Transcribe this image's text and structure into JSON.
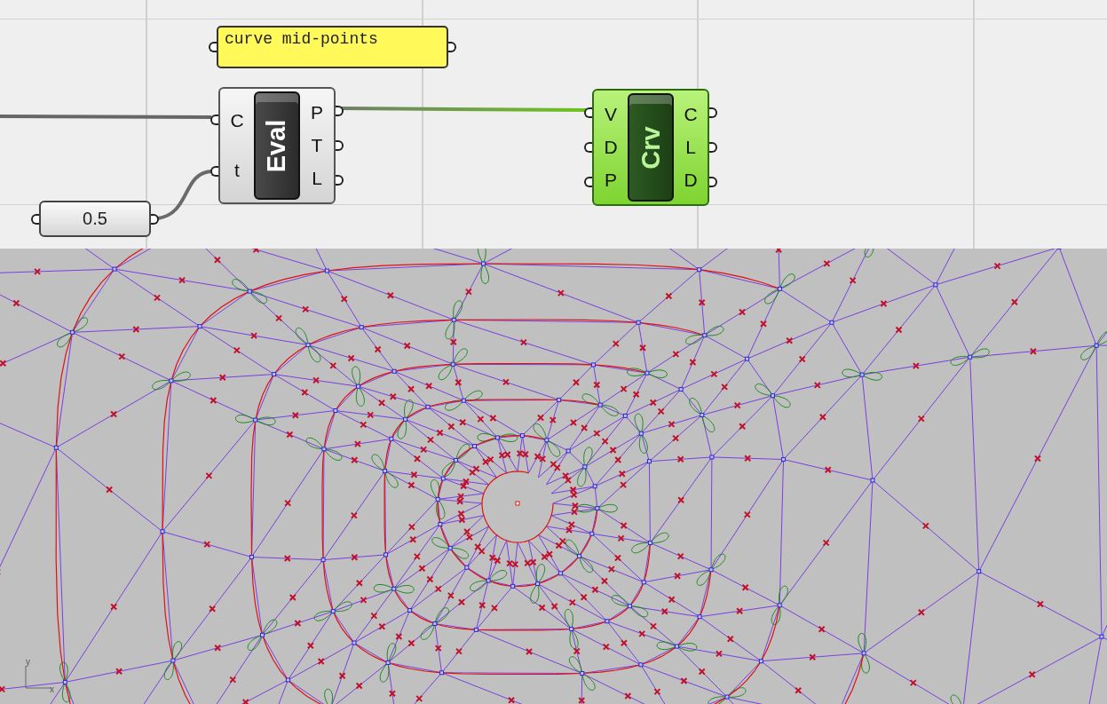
{
  "canvas": {
    "panel": {
      "text": "curve mid-points"
    },
    "slider": {
      "value": "0.5"
    },
    "components": [
      {
        "name": "Eval",
        "kind": "standard",
        "inputs": [
          "C",
          "t"
        ],
        "outputs": [
          "P",
          "T",
          "L"
        ]
      },
      {
        "name": "Crv",
        "kind": "preview",
        "inputs": [
          "V",
          "D",
          "P"
        ],
        "outputs": [
          "C",
          "L",
          "D"
        ]
      }
    ]
  },
  "viewport": {
    "axis_labels": [
      "y",
      "x"
    ]
  }
}
